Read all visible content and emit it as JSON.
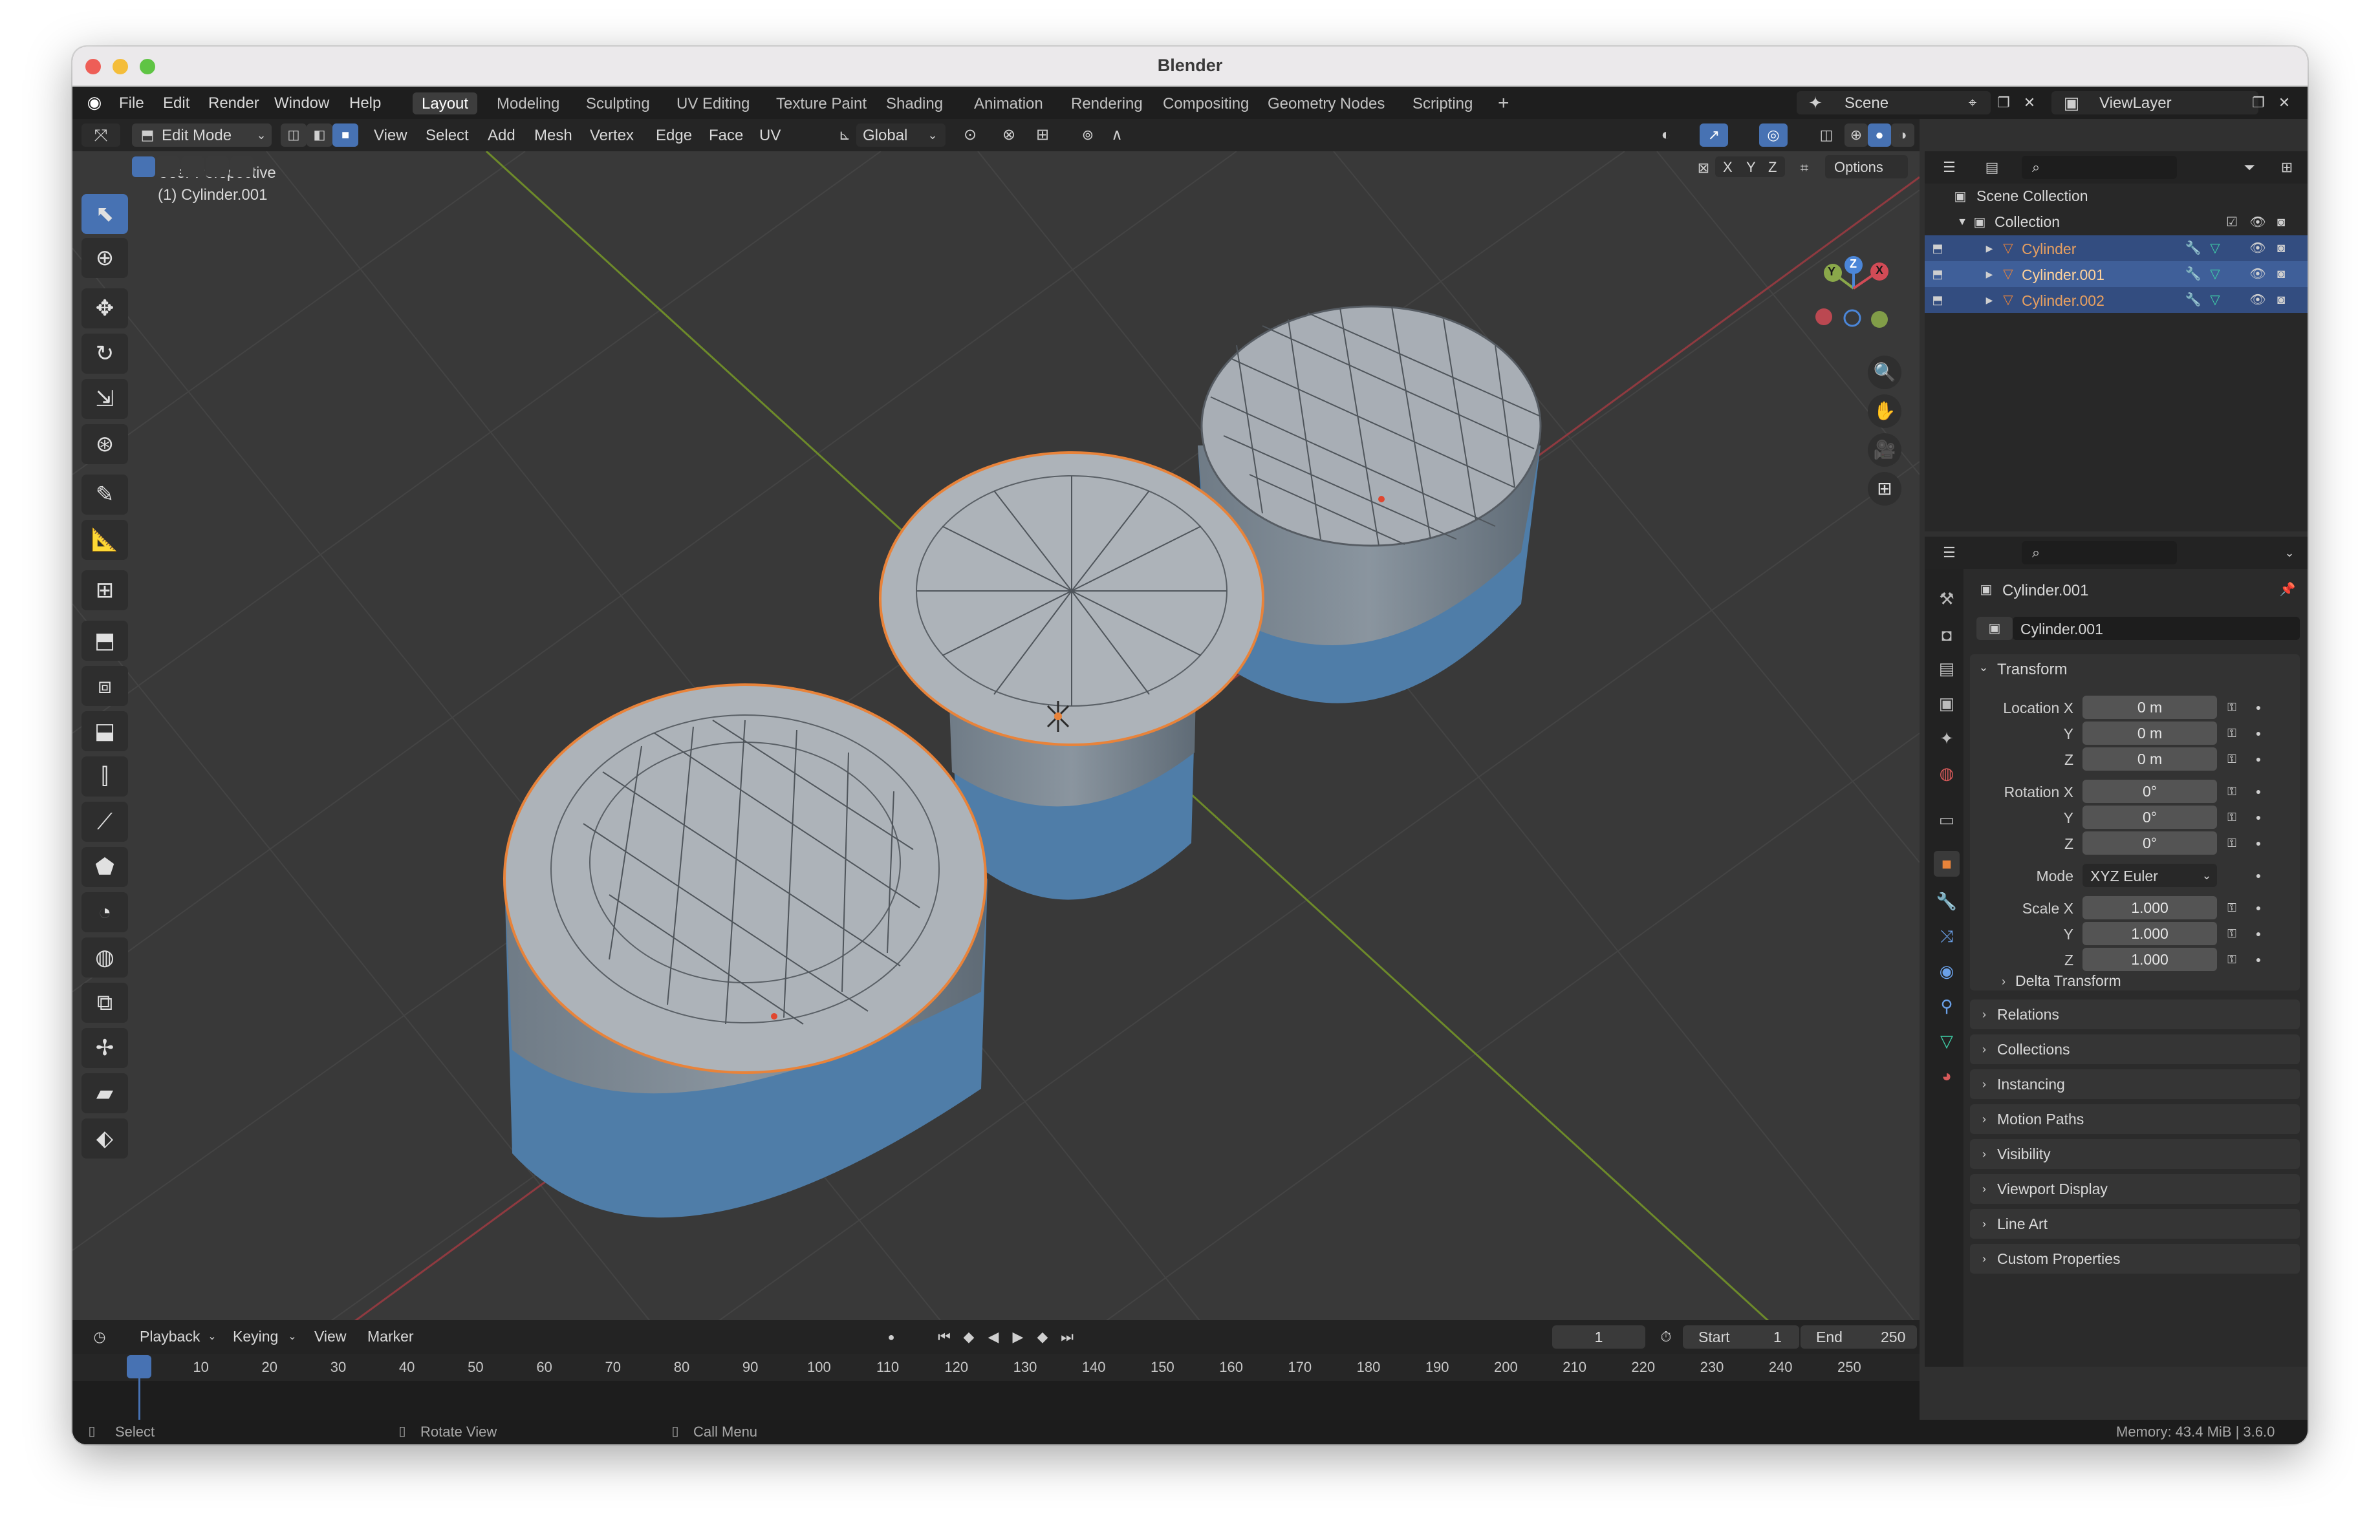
{
  "window": {
    "title": "Blender"
  },
  "menu": {
    "items": [
      "File",
      "Edit",
      "Render",
      "Window",
      "Help"
    ],
    "workspaces": [
      "Layout",
      "Modeling",
      "Sculpting",
      "UV Editing",
      "Texture Paint",
      "Shading",
      "Animation",
      "Rendering",
      "Compositing",
      "Geometry Nodes",
      "Scripting"
    ],
    "active_workspace": "Layout",
    "add_workspace": "+",
    "scene": "Scene",
    "view_layer": "ViewLayer"
  },
  "header3d": {
    "mode": "Edit Mode",
    "menus": [
      "View",
      "Select",
      "Add",
      "Mesh",
      "Vertex",
      "Edge",
      "Face",
      "UV"
    ],
    "transform_orientation": "Global",
    "axis_x": "X",
    "axis_y": "Y",
    "axis_z": "Z",
    "options": "Options"
  },
  "viewport": {
    "perspective_label": "User Perspective",
    "object_label": "(1) Cylinder.001",
    "gizmo": {
      "x": "X",
      "y": "Y",
      "z": "Z"
    }
  },
  "outliner": {
    "scene_collection": "Scene Collection",
    "collection": "Collection",
    "objects": [
      "Cylinder",
      "Cylinder.001",
      "Cylinder.002"
    ]
  },
  "properties": {
    "object_name": "Cylinder.001",
    "datablock": "Cylinder.001",
    "transform": {
      "title": "Transform",
      "location_label": "Location X",
      "location": [
        "0 m",
        "0 m",
        "0 m"
      ],
      "rotation_label": "Rotation X",
      "rotation": [
        "0°",
        "0°",
        "0°"
      ],
      "mode_label": "Mode",
      "mode": "XYZ Euler",
      "scale_label": "Scale X",
      "scale": [
        "1.000",
        "1.000",
        "1.000"
      ],
      "y_label": "Y",
      "z_label": "Z",
      "delta": "Delta Transform"
    },
    "panels": [
      "Relations",
      "Collections",
      "Instancing",
      "Motion Paths",
      "Visibility",
      "Viewport Display",
      "Line Art",
      "Custom Properties"
    ]
  },
  "timeline": {
    "menus": [
      "Playback",
      "Keying",
      "View",
      "Marker"
    ],
    "current_frame": "1",
    "start_label": "Start",
    "start": "1",
    "end_label": "End",
    "end": "250",
    "ruler": [
      "1",
      "10",
      "20",
      "30",
      "40",
      "50",
      "60",
      "70",
      "80",
      "90",
      "100",
      "110",
      "120",
      "130",
      "140",
      "150",
      "160",
      "170",
      "180",
      "190",
      "200",
      "210",
      "220",
      "230",
      "240",
      "250"
    ]
  },
  "statusbar": {
    "select": "Select",
    "rotate": "Rotate View",
    "call_menu": "Call Menu",
    "memory": "Memory: 43.4 MiB | 3.6.0"
  },
  "colors": {
    "accent": "#4772b3",
    "selected_object": "#e8833a",
    "x_axis": "#c2414d",
    "y_axis": "#7fa82a",
    "z_axis": "#3b7ad6",
    "mesh_face": "#a7adb4",
    "mesh_side": "#5b7998"
  }
}
